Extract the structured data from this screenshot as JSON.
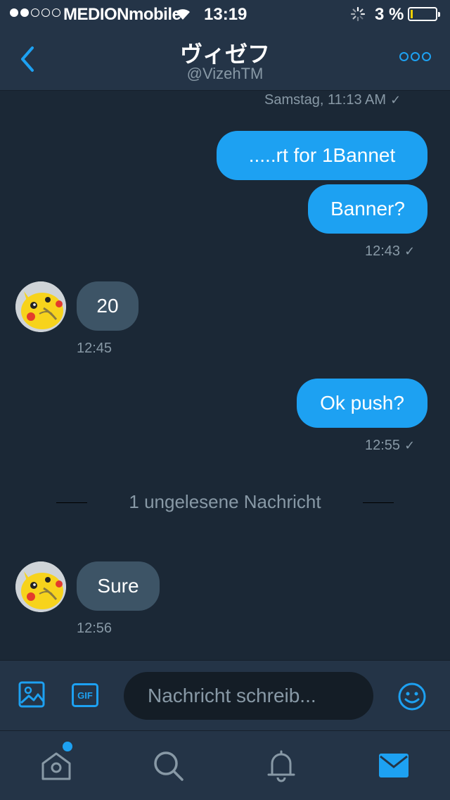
{
  "status_bar": {
    "carrier": "MEDIONmobile",
    "time": "13:19",
    "battery_percent": "3 %",
    "battery_level": 0.03,
    "signal_bars_filled": 2,
    "signal_bars_total": 5
  },
  "header": {
    "title": "ヴィゼフ",
    "handle": "@VizehTM"
  },
  "conversation": {
    "first_timestamp": "Samstag, 11:13 AM",
    "messages": [
      {
        "from": "me",
        "text": ".....rt for 1Bannet"
      },
      {
        "from": "me",
        "text": "Banner?",
        "time": "12:43"
      },
      {
        "from": "them",
        "text": "20",
        "time": "12:45"
      },
      {
        "from": "me",
        "text": "Ok push?",
        "time": "12:55"
      },
      {
        "from": "them",
        "text": "Sure",
        "time": "12:56"
      }
    ],
    "unread_divider": "1 ungelesene Nachricht",
    "read_check": "✓"
  },
  "composer": {
    "gif_label": "GIF",
    "placeholder": "Nachricht schreib..."
  },
  "colors": {
    "background": "#1b2836",
    "bar": "#243447",
    "accent": "#1da1f2",
    "incoming_bubble": "#3d5466",
    "secondary_text": "#8899a6"
  },
  "tabs": [
    "home-icon",
    "search-icon",
    "bell-icon",
    "mail-icon"
  ]
}
